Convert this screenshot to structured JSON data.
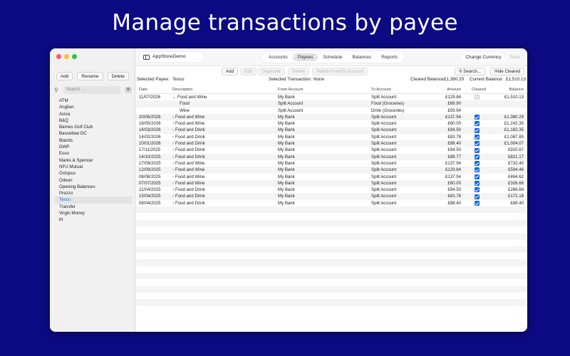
{
  "headline": "Manage transactions by payee",
  "sidebar": {
    "buttons": {
      "add": "Add",
      "rename": "Rename",
      "delete": "Delete"
    },
    "search_placeholder": "Search ...",
    "clear_glyph": "⊗",
    "payees": [
      "ATM",
      "Anglian",
      "Aviva",
      "B&Q",
      "Barnes Golf Club",
      "Bassetlaw DC",
      "Blands",
      "DWP",
      "Esso",
      "Marks & Spencer",
      "NFU Mutual",
      "Octopus",
      "Odeon",
      "Opening Balances",
      "Prezzo",
      "Tesco",
      "Transfer",
      "Virgin Money",
      "bt"
    ],
    "selected_payee": "Tesco"
  },
  "toolbar": {
    "app_name": "AppStoreDemo",
    "tabs": [
      "Accounts",
      "Payees",
      "Schedule",
      "Balances",
      "Reports"
    ],
    "active_tab": "Payees",
    "change_currency": "Change Currency",
    "save": "Save"
  },
  "actions": {
    "add": "Add",
    "edit": "Edit",
    "duplicate": "Duplicate",
    "delete": "Delete",
    "switch": "Switch From/To Account",
    "search": "Search...",
    "hide_cleared": "Hide Cleared"
  },
  "info": {
    "selected_payee_label": "Selected Payee:",
    "selected_payee_value": "Tesco",
    "selected_transaction_label": "Selected Transaction:",
    "selected_transaction_value": "None",
    "cleared_balance_label": "Cleared Balance:",
    "cleared_balance_value": "£1,380.29",
    "current_balance_label": "Current Balance:",
    "current_balance_value": "£1,510.13"
  },
  "table": {
    "headers": {
      "date": "Date",
      "description": "Description",
      "from": "From Account",
      "to": "To Account",
      "amount": "Amount",
      "cleared": "Cleared",
      "balance": "Balance"
    },
    "rows": [
      {
        "date": "11/07/2026",
        "expand": "⌄",
        "desc": "Food and Wine",
        "from": "My Bank",
        "to": "Split Account",
        "amount": "£129.84",
        "cleared": "off",
        "balance": "£1,510.13"
      },
      {
        "date": "",
        "expand": "",
        "desc": "Food",
        "from": "Split Account",
        "to": "Food (Groceries)",
        "amount": "£69.90",
        "cleared": "none",
        "balance": ""
      },
      {
        "date": "",
        "expand": "",
        "desc": "Wine",
        "from": "Split Account",
        "to": "Drink (Groceries)",
        "amount": "£59.94",
        "cleared": "none",
        "balance": ""
      },
      {
        "date": "20/06/2026",
        "expand": "›",
        "desc": "Food and Wine",
        "from": "My Bank",
        "to": "Split Account",
        "amount": "£137.94",
        "cleared": "on",
        "balance": "£1,380.29"
      },
      {
        "date": "16/05/2026",
        "expand": "›",
        "desc": "Food and Wine",
        "from": "My Bank",
        "to": "Split Account",
        "amount": "£60.00",
        "cleared": "on",
        "balance": "£1,242.35"
      },
      {
        "date": "14/03/2026",
        "expand": "›",
        "desc": "Food and Drink",
        "from": "My Bank",
        "to": "Split Account",
        "amount": "£94.50",
        "cleared": "on",
        "balance": "£1,182.35"
      },
      {
        "date": "14/02/2026",
        "expand": "›",
        "desc": "Food and Drink",
        "from": "My Bank",
        "to": "Split Account",
        "amount": "£83.78",
        "cleared": "on",
        "balance": "£1,087.85"
      },
      {
        "date": "10/01/2026",
        "expand": "›",
        "desc": "Food and Drink",
        "from": "My Bank",
        "to": "Split Account",
        "amount": "£88.40",
        "cleared": "on",
        "balance": "£1,004.07"
      },
      {
        "date": "17/11/2025",
        "expand": "›",
        "desc": "Food and Drink",
        "from": "My Bank",
        "to": "Split Account",
        "amount": "£94.50",
        "cleared": "on",
        "balance": "£915.67"
      },
      {
        "date": "14/10/2025",
        "expand": "›",
        "desc": "Food and Drink",
        "from": "My Bank",
        "to": "Split Account",
        "amount": "£88.77",
        "cleared": "on",
        "balance": "£821.17"
      },
      {
        "date": "17/09/2025",
        "expand": "›",
        "desc": "Food and Wine",
        "from": "My Bank",
        "to": "Split Account",
        "amount": "£137.94",
        "cleared": "on",
        "balance": "£732.40"
      },
      {
        "date": "12/09/2025",
        "expand": "›",
        "desc": "Food and Wine",
        "from": "My Bank",
        "to": "Split Account",
        "amount": "£129.84",
        "cleared": "on",
        "balance": "£594.46"
      },
      {
        "date": "08/08/2025",
        "expand": "›",
        "desc": "Food and Wine",
        "from": "My Bank",
        "to": "Split Account",
        "amount": "£137.94",
        "cleared": "on",
        "balance": "£464.62"
      },
      {
        "date": "07/07/2025",
        "expand": "›",
        "desc": "Food and Wine",
        "from": "My Bank",
        "to": "Split Account",
        "amount": "£60.00",
        "cleared": "on",
        "balance": "£326.68"
      },
      {
        "date": "21/04/2025",
        "expand": "›",
        "desc": "Food and Drink",
        "from": "My Bank",
        "to": "Split Account",
        "amount": "£94.50",
        "cleared": "on",
        "balance": "£266.68"
      },
      {
        "date": "15/04/2025",
        "expand": "›",
        "desc": "Food and Drink",
        "from": "My Bank",
        "to": "Split Account",
        "amount": "£83.78",
        "cleared": "on",
        "balance": "£172.18"
      },
      {
        "date": "08/04/2025",
        "expand": "›",
        "desc": "Food and Drink",
        "from": "My Bank",
        "to": "Split Account",
        "amount": "£88.40",
        "cleared": "on",
        "balance": "£88.40"
      }
    ]
  },
  "colors": {
    "background": "#0c0a82",
    "accent": "#1669e0",
    "selected_text": "#1a6ef0"
  }
}
